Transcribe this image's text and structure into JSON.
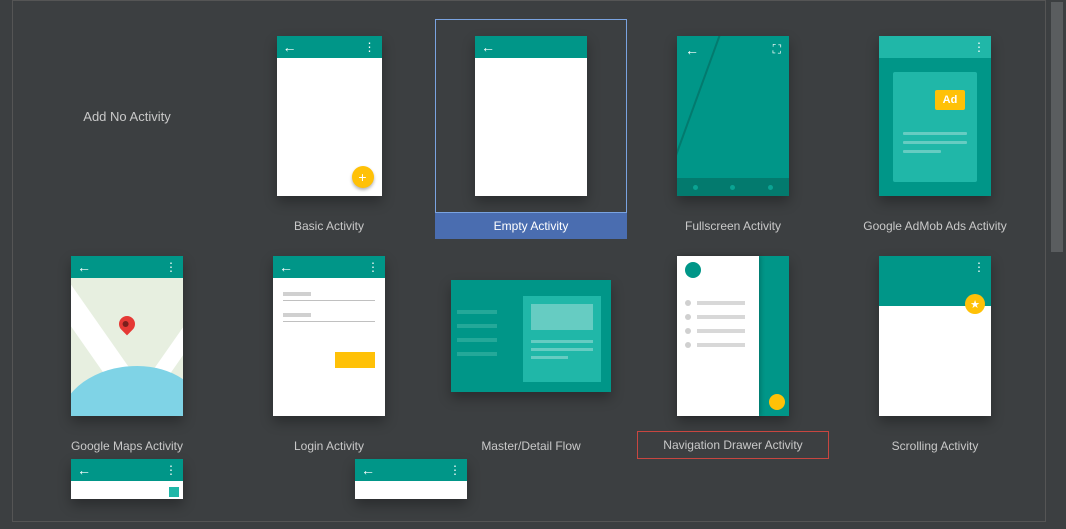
{
  "tiles": {
    "add_no_activity": {
      "label": "Add No Activity"
    },
    "basic": {
      "label": "Basic Activity"
    },
    "empty": {
      "label": "Empty Activity",
      "selected": true
    },
    "fullscreen": {
      "label": "Fullscreen Activity"
    },
    "admob": {
      "label": "Google AdMob Ads Activity",
      "ad_badge": "Ad"
    },
    "maps": {
      "label": "Google Maps Activity"
    },
    "login": {
      "label": "Login Activity"
    },
    "master_detail": {
      "label": "Master/Detail Flow"
    },
    "nav_drawer": {
      "label": "Navigation Drawer Activity",
      "highlighted": true
    },
    "scrolling": {
      "label": "Scrolling Activity"
    }
  },
  "colors": {
    "teal": "#009688",
    "teal_light": "#20b7a8",
    "amber": "#ffc107",
    "selection_blue": "#4a6db0",
    "highlight_red": "#c84640"
  }
}
